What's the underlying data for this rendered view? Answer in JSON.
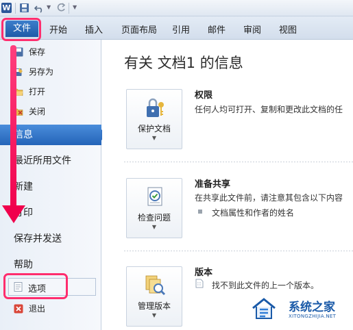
{
  "qat": {
    "app_letter": "W"
  },
  "ribbon": {
    "file_tab": "文件",
    "tabs": [
      "开始",
      "插入",
      "页面布局",
      "引用",
      "邮件",
      "审阅",
      "视图"
    ]
  },
  "nav": {
    "small_items": [
      "保存",
      "另存为",
      "打开",
      "关闭"
    ],
    "big_items": [
      "信息",
      "最近所用文件",
      "新建",
      "打印",
      "保存并发送",
      "帮助"
    ],
    "options": "选项",
    "exit": "退出"
  },
  "main": {
    "title": "有关 文档1 的信息",
    "sections": [
      {
        "button": "保护文档",
        "title": "权限",
        "text": "任何人均可打开、复制和更改此文档的任"
      },
      {
        "button": "检查问题",
        "title": "准备共享",
        "text": "在共享此文件前，请注意其包含以下内容",
        "bullet": "文档属性和作者的姓名"
      },
      {
        "button": "管理版本",
        "title": "版本",
        "text": "找不到此文件的上一个版本。"
      }
    ]
  },
  "watermark": {
    "name": "系统之家",
    "url": "XITONGZHIJIA.NET"
  },
  "colors": {
    "accent": "#2464b8",
    "highlight": "#ff2d6e"
  }
}
